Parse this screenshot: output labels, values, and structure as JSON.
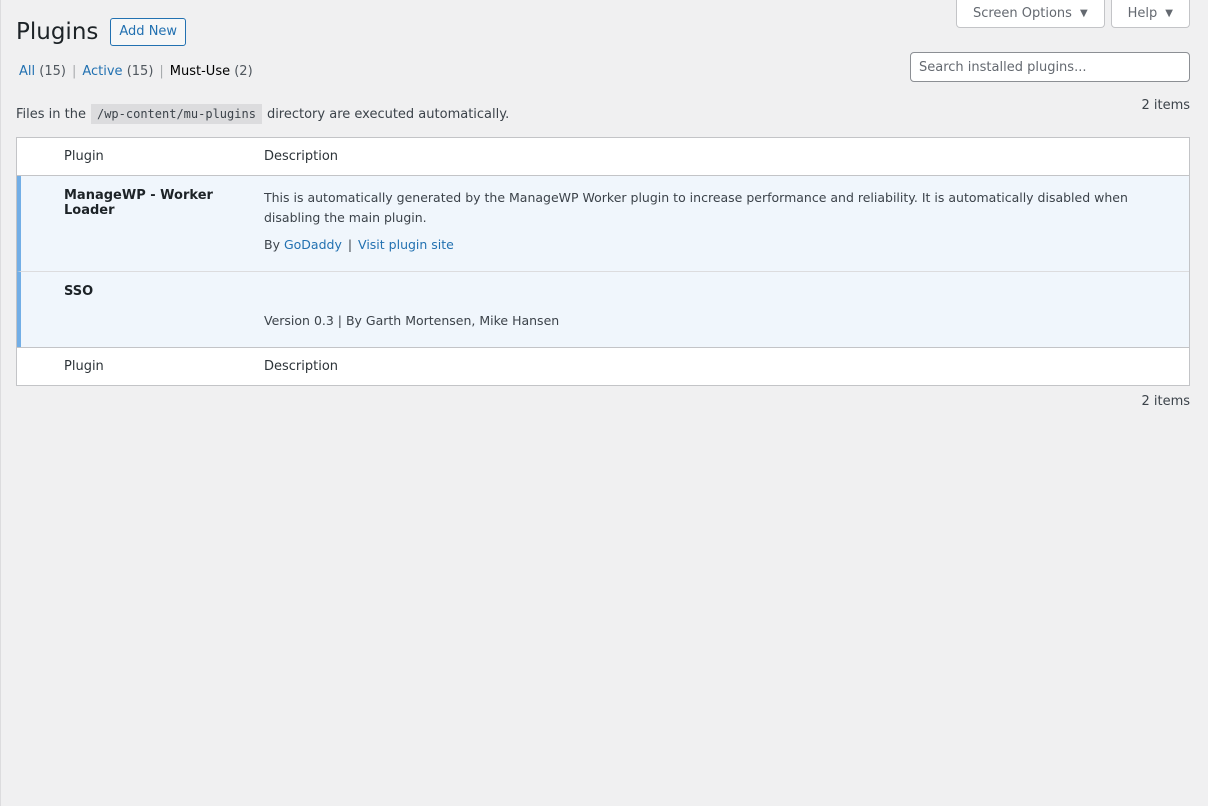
{
  "header": {
    "title": "Plugins",
    "add_new_label": "Add New",
    "screen_options_label": "Screen Options",
    "help_label": "Help",
    "arrow_icon": "triangle-down"
  },
  "filters": [
    {
      "label": "All",
      "count": "(15)",
      "current": false
    },
    {
      "label": "Active",
      "count": "(15)",
      "current": false
    },
    {
      "label": "Must-Use",
      "count": "(2)",
      "current": true
    }
  ],
  "search": {
    "placeholder": "Search installed plugins..."
  },
  "items_count": "2 items",
  "notice": {
    "before": "Files in the",
    "code": "/wp-content/mu-plugins",
    "after": "directory are executed automatically."
  },
  "table": {
    "columns": [
      "Plugin",
      "Description"
    ],
    "rows": [
      {
        "name": "ManageWP - Worker Loader",
        "description": "This is automatically generated by the ManageWP Worker plugin to increase performance and reliability. It is automatically disabled when disabling the main plugin.",
        "by_label": "By",
        "author": "GoDaddy",
        "separator": "|",
        "visit_label": "Visit plugin site"
      },
      {
        "name": "SSO",
        "description": "",
        "meta": "Version 0.3 | By Garth Mortensen, Mike Hansen"
      }
    ]
  },
  "colors": {
    "link": "#2271b1",
    "row_highlight": "#72aee6",
    "row_background": "#f0f6fc"
  }
}
